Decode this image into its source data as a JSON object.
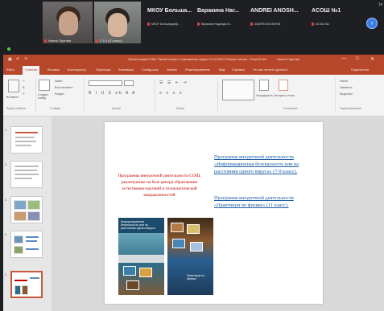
{
  "conference": {
    "participants": [
      {
        "name": "Ирина Пуртова",
        "mic": ""
      },
      {
        "name": "2 3 4 (IT-класс)",
        "mic": ""
      }
    ],
    "others": [
      {
        "name": "МКОУ Больша...",
        "sub": "МКОУ Большедорбр..."
      },
      {
        "name": "Варакина Наг...",
        "sub": "Варакина Надежда М..."
      },
      {
        "name": "ANDREI ANOSH...",
        "sub": "ANDREI ANOSHKIN"
      },
      {
        "name": "ACOШ №1",
        "sub": "АСОШ №1"
      }
    ],
    "badge": "1▾",
    "next_icon": "chevron-right-icon"
  },
  "window": {
    "title": "Презентация СОШ. Презентация к совещанию округа 21.04.2021 Режим чтения · PowerPoint",
    "user": "Ирина Пуртова",
    "controls": [
      "—",
      "□",
      "✕"
    ]
  },
  "menu": {
    "items": [
      "Файл",
      "Главная",
      "Вставка",
      "Конструктор",
      "Переходы",
      "Анимация",
      "Слайд-шоу",
      "Запись",
      "Рецензирование",
      "Вид",
      "Справка",
      "Что вы хотите сделать?"
    ],
    "share": "Поделиться"
  },
  "ribbon": {
    "groups": [
      "Буфер обмена",
      "Слайды",
      "Шрифт",
      "Абзац",
      "Рисование",
      "Редактирование"
    ],
    "paste": "Вставить",
    "new_slide": "Создать слайд",
    "layout": "Макет",
    "reset": "Восстановить",
    "section": "Раздел",
    "arrange": "Упорядочить",
    "quick_styles": "Экспресс-стили",
    "find": "Найти",
    "replace": "Заменить",
    "select": "Выделить"
  },
  "thumbnails": {
    "numbers": [
      "1",
      "2",
      "3",
      "4",
      "5"
    ],
    "selected": "5"
  },
  "slide": {
    "left_text": "Программы внеурочной деятельности СОШ, реализуемые на базе центра образования естественно-научной и технологической направленностей",
    "right_text_1": "Программа внеурочной деятельности «Информационная безопасность или на расстоянии одного вируса» (7-9 класс).",
    "right_text_2": "Программа внеурочной деятельности «Практикум по физике» (11 класс).",
    "book1_title": "Информационная безопасность или на расстоянии одного вируса",
    "book2_title": "Практикум по физике"
  }
}
